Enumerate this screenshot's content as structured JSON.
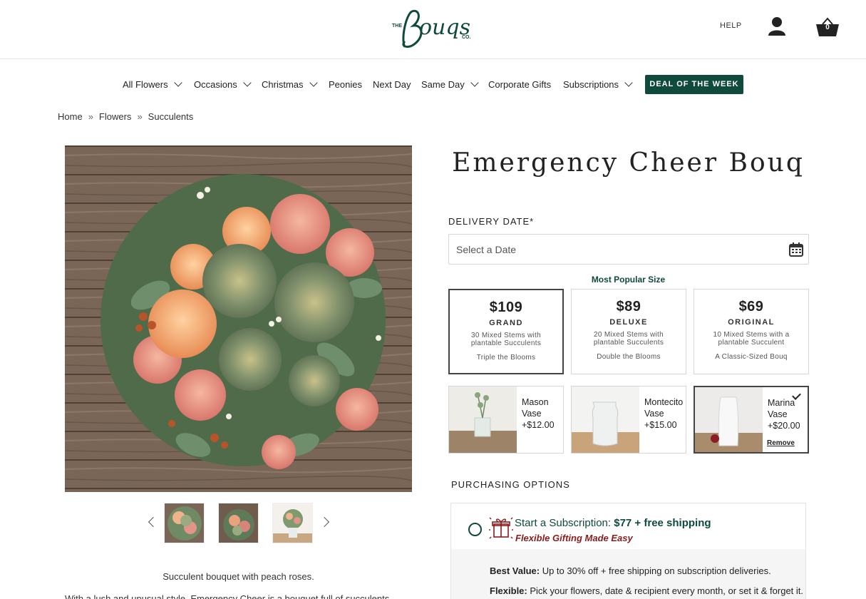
{
  "header": {
    "logo_text": "The Bouqs Co.",
    "help_label": "HELP",
    "cart_count": "0",
    "icons": {
      "account": "user-icon",
      "cart": "basket-icon"
    }
  },
  "nav": {
    "items": [
      {
        "label": "All Flowers",
        "has_dropdown": true
      },
      {
        "label": "Occasions",
        "has_dropdown": true
      },
      {
        "label": "Christmas",
        "has_dropdown": true
      },
      {
        "label": "Peonies",
        "has_dropdown": false
      },
      {
        "label": "Next Day",
        "has_dropdown": false
      },
      {
        "label": "Same Day",
        "has_dropdown": true
      },
      {
        "label": "Corporate Gifts",
        "has_dropdown": false
      },
      {
        "label": "Subscriptions",
        "has_dropdown": true
      }
    ],
    "deal_label": "DEAL OF THE WEEK"
  },
  "breadcrumb": {
    "items": [
      "Home",
      "Flowers",
      "Succulents"
    ],
    "separator": "»"
  },
  "gallery": {
    "caption": "Succulent bouquet with peach roses.",
    "description": "With a lush and unusual style, Emergency Cheer is a bouquet full of succulents"
  },
  "product": {
    "title": "Emergency Cheer Bouq",
    "delivery_label": "DELIVERY DATE*",
    "date_placeholder": "Select a Date",
    "most_popular_label": "Most Popular Size",
    "sizes": [
      {
        "price": "$109",
        "tier": "GRAND",
        "stems": "30 Mixed Stems with plantable Succulents",
        "extra": "Triple the Blooms",
        "selected": true
      },
      {
        "price": "$89",
        "tier": "DELUXE",
        "stems": "20 Mixed Stems with plantable Succulents",
        "extra": "Double the Blooms",
        "selected": false
      },
      {
        "price": "$69",
        "tier": "ORIGINAL",
        "stems": "10 Mixed Stems with a plantable Succulent",
        "extra": "A Classic-Sized Bouq",
        "selected": false
      }
    ],
    "vases": [
      {
        "name": "Mason Vase",
        "price": "+$12.00",
        "selected": false
      },
      {
        "name": "Montecito Vase",
        "price": "+$15.00",
        "selected": false
      },
      {
        "name": "Marina Vase",
        "price": "+$20.00",
        "selected": true,
        "remove_label": "Remove"
      }
    ]
  },
  "purchasing": {
    "label": "PURCHASING OPTIONS",
    "subscription": {
      "title_prefix": "Start a Subscription: ",
      "title_price": "$77 + free shipping",
      "tagline": "Flexible Gifting Made Easy",
      "benefits": [
        {
          "bold": "Best Value:",
          "text": " Up to 30% off + free shipping on subscription deliveries."
        },
        {
          "bold": "Flexible:",
          "text": " Pick your flowers, date & recipient every month, or set it & forget it."
        }
      ]
    }
  },
  "colors": {
    "brand_green": "#0f4a3c",
    "tagline_red": "#8a1c1c"
  }
}
